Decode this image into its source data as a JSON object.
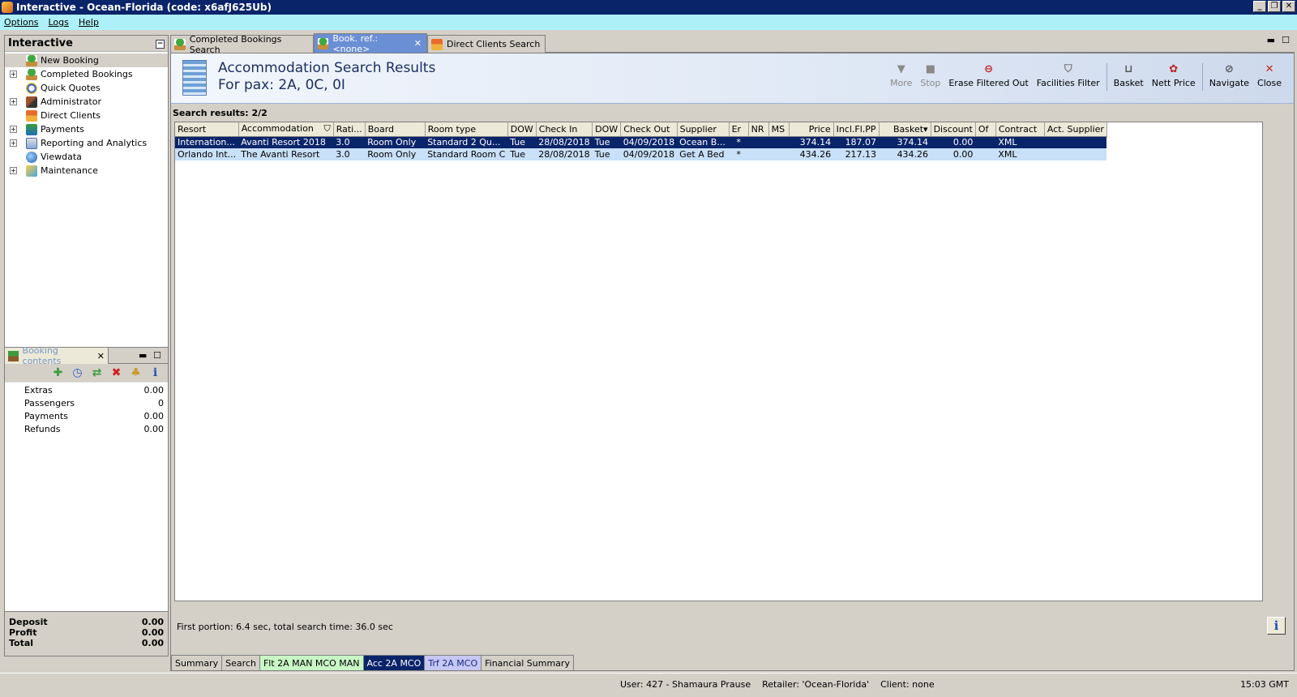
{
  "window": {
    "title": "Interactive - Ocean-Florida (code: x6afJ625Ub)"
  },
  "menu": [
    "Options",
    "Logs",
    "Help"
  ],
  "left_panel": {
    "title": "Interactive",
    "items": [
      {
        "label": "New Booking",
        "icon": "palm-icon",
        "expandable": false,
        "selected": true
      },
      {
        "label": "Completed Bookings",
        "icon": "palm-icon",
        "expandable": true
      },
      {
        "label": "Quick Quotes",
        "icon": "clock-icon",
        "expandable": false
      },
      {
        "label": "Administrator",
        "icon": "admin-icon",
        "expandable": true
      },
      {
        "label": "Direct Clients",
        "icon": "hut-icon",
        "expandable": false
      },
      {
        "label": "Payments",
        "icon": "payments-icon",
        "expandable": true
      },
      {
        "label": "Reporting and Analytics",
        "icon": "report-icon",
        "expandable": true
      },
      {
        "label": "Viewdata",
        "icon": "globe-icon",
        "expandable": false
      },
      {
        "label": "Maintenance",
        "icon": "box-icon",
        "expandable": true
      }
    ]
  },
  "booking_panel": {
    "tab_label": "Booking contents",
    "rows": [
      {
        "label": "Extras",
        "value": "0.00"
      },
      {
        "label": "Passengers",
        "value": "0"
      },
      {
        "label": "Payments",
        "value": "0.00"
      },
      {
        "label": "Refunds",
        "value": "0.00"
      }
    ],
    "totals": [
      {
        "label": "Deposit",
        "value": "0.00"
      },
      {
        "label": "Profit",
        "value": "0.00"
      },
      {
        "label": "Total",
        "value": "0.00"
      }
    ]
  },
  "tabs": [
    {
      "label": "Completed Bookings Search",
      "active": false
    },
    {
      "label": "Book. ref.: <none>",
      "active": true
    },
    {
      "label": "Direct Clients Search",
      "active": false
    }
  ],
  "results": {
    "title": "Accommodation Search Results",
    "subtitle": "For pax: 2A, 0C, 0I",
    "count_label": "Search results: 2/2",
    "timing": "First portion: 6.4 sec, total search time: 36.0 sec"
  },
  "toolbar": [
    {
      "label": "More",
      "icon": "more-icon",
      "disabled": true
    },
    {
      "label": "Stop",
      "icon": "stop-icon",
      "disabled": true
    },
    {
      "label": "Erase Filtered Out",
      "icon": "erase-icon",
      "disabled": false
    },
    {
      "label": "Facilities Filter",
      "icon": "filter-icon",
      "disabled": false
    },
    {
      "label": "Basket",
      "icon": "basket-icon",
      "disabled": false
    },
    {
      "label": "Nett Price",
      "icon": "nett-price-icon",
      "disabled": false
    },
    {
      "label": "Navigate",
      "icon": "navigate-icon",
      "disabled": false
    },
    {
      "label": "Close",
      "icon": "close-icon",
      "disabled": false
    }
  ],
  "grid": {
    "columns": [
      "Resort",
      "Accommodation",
      "Rati...",
      "Board",
      "Room type",
      "DOW",
      "Check In",
      "DOW",
      "Check Out",
      "Supplier",
      "Er",
      "NR",
      "MS",
      "Price",
      "Incl.Fl.PP",
      "Basket",
      "Discount",
      "Of",
      "Contract",
      "Act. Supplier"
    ],
    "rows": [
      [
        "Internation...",
        "Avanti Resort 2018",
        "3.0",
        "Room Only",
        "Standard 2 Qu...",
        "Tue",
        "28/08/2018",
        "Tue",
        "04/09/2018",
        "Ocean B...",
        "*",
        "",
        "",
        "374.14",
        "187.07",
        "374.14",
        "0.00",
        "",
        "XML",
        ""
      ],
      [
        "Orlando Int...",
        "The Avanti Resort",
        "3.0",
        "Room Only",
        "Standard Room C",
        "Tue",
        "28/08/2018",
        "Tue",
        "04/09/2018",
        "Get A Bed",
        "*",
        "",
        "",
        "434.26",
        "217.13",
        "434.26",
        "0.00",
        "",
        "XML",
        ""
      ]
    ]
  },
  "bottom_tabs": [
    "Summary",
    "Search",
    "Flt 2A MAN MCO MAN",
    "Acc 2A MCO",
    "Trf 2A MCO",
    "Financial Summary"
  ],
  "status": {
    "user": "User: 427 - Shamaura Prause",
    "retailer": "Retailer: 'Ocean-Florida'",
    "client": "Client: none",
    "time": "15:03 GMT"
  }
}
